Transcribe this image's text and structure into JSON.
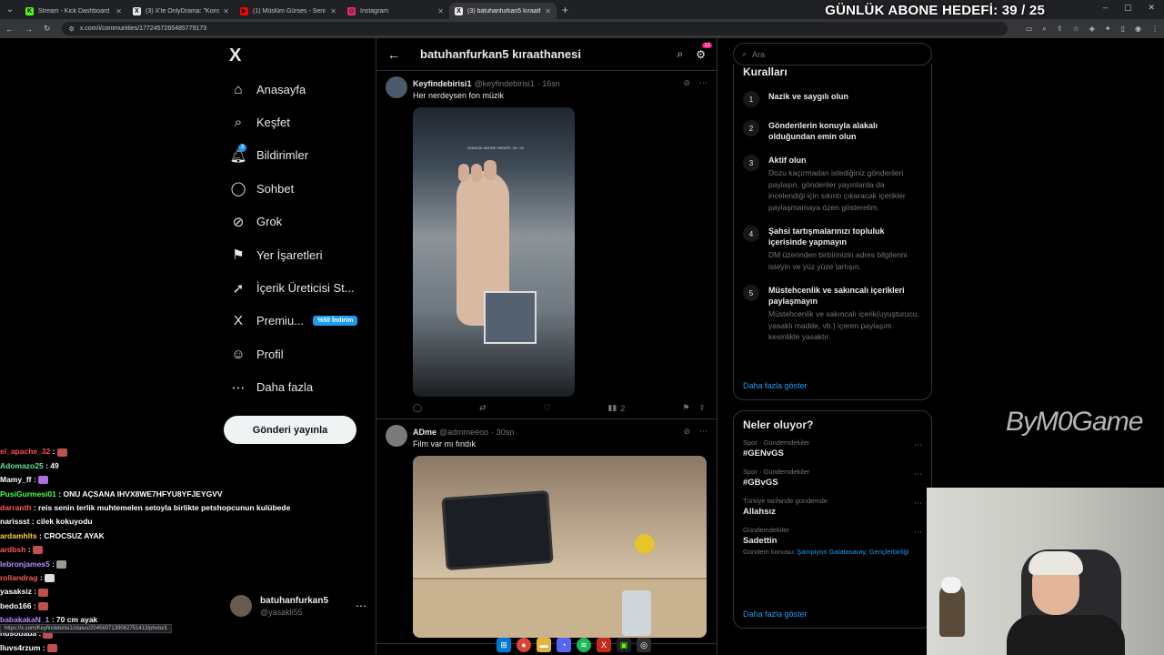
{
  "browser": {
    "tabs": [
      {
        "title": "Stream - Kick Dashboard",
        "fav_color": "#53fc18",
        "fav_glyph": "K",
        "active": false
      },
      {
        "title": "(3) X'te OnlyDrama: \"Konsol O",
        "fav_color": "#e7e9ea",
        "fav_glyph": "X",
        "active": false
      },
      {
        "title": "(1) Müslüm Gürses - Seni Yazdı",
        "fav_color": "#ff0000",
        "fav_glyph": "▶",
        "active": false
      },
      {
        "title": "Instagram",
        "fav_color": "#e1306c",
        "fav_glyph": "◎",
        "active": false
      },
      {
        "title": "(3) batuhanfurkan5 kıraathanes",
        "fav_color": "#e7e9ea",
        "fav_glyph": "X",
        "active": true
      }
    ],
    "url": "x.com/i/communities/1772457265485779173",
    "status_url": "https://x.com/Keyfindebirisi1/status/2045607139062751413/photo/1"
  },
  "overlay": {
    "abone_hedefi": "GÜNLÜK ABONE HEDEFİ: 39 / 25",
    "watermark": "ByM0Game"
  },
  "x_nav": {
    "logo": "X",
    "items": [
      {
        "label": "Anasayfa",
        "icon": "home-icon",
        "glyph": "⌂"
      },
      {
        "label": "Keşfet",
        "icon": "search-icon",
        "glyph": "⌕"
      },
      {
        "label": "Bildirimler",
        "icon": "bell-icon",
        "glyph": "🔔︎",
        "badge": "3"
      },
      {
        "label": "Sohbet",
        "icon": "chat-icon",
        "glyph": "◯"
      },
      {
        "label": "Grok",
        "icon": "grok-icon",
        "glyph": "⊘"
      },
      {
        "label": "Yer İşaretleri",
        "icon": "bookmark-icon",
        "glyph": "⚑"
      },
      {
        "label": "İçerik Üreticisi St...",
        "icon": "rocket-icon",
        "glyph": "➚"
      },
      {
        "label": "Premiu...",
        "icon": "x-premium-icon",
        "glyph": "X",
        "promo": "%50 İndirim"
      },
      {
        "label": "Profil",
        "icon": "profile-icon",
        "glyph": "☺"
      },
      {
        "label": "Daha fazla",
        "icon": "more-icon",
        "glyph": "⋯"
      }
    ],
    "post_button": "Gönderi yayınla",
    "profile_name": "batuhanfurkan5",
    "profile_handle": "@yasakli55"
  },
  "community": {
    "title": "batuhanfurkan5 kıraathanesi",
    "settings_badge": "12"
  },
  "tweets": [
    {
      "name": "Keyfindebirisi1",
      "handle": "@keyfindebirisi1",
      "time": "· 16sn",
      "text": "Her nerdeysen fon müzik",
      "views": "2"
    },
    {
      "name": "ADme",
      "handle": "@admmeeoo",
      "time": "· 30sn",
      "text": "Film var mı fındık",
      "views": ""
    }
  ],
  "media_text": "GÜNLÜK ABONE HEDEFİ: 39 / 25",
  "search": {
    "placeholder": "Ara"
  },
  "rules": {
    "title": "Kuralları",
    "items": [
      {
        "num": "1",
        "title": "Nazik ve saygılı olun",
        "desc": ""
      },
      {
        "num": "2",
        "title": "Gönderilerin konuyla alakalı olduğundan emin olun",
        "desc": ""
      },
      {
        "num": "3",
        "title": "Aktif olun",
        "desc": "Dozu kaçırmadan istediğiniz gönderileri paylaşın, gönderiler yayınlarda da incelendiği için sıkıntı çıkaracak içerikler paylaşmamaya özen gösterelim."
      },
      {
        "num": "4",
        "title": "Şahsi tartışmalarınızı topluluk içerisinde yapmayın",
        "desc": "DM üzerinden birbirinizin adres bilgilerini isteyin ve yüz yüze tartışın."
      },
      {
        "num": "5",
        "title": "Müstehcenlik ve sakıncalı içerikleri paylaşmayın",
        "desc": "Müstehcenlik ve sakıncalı içerik(uyuşturucu, yasaklı madde, vb.) içeren paylaşım kesinlikle yasaktır."
      }
    ],
    "more": "Daha fazla göster"
  },
  "trends": {
    "title": "Neler oluyor?",
    "items": [
      {
        "context": "Spor · Gündemdekiler",
        "name": "#GENvGS",
        "sub": "",
        "link": ""
      },
      {
        "context": "Spor · Gündemdekiler",
        "name": "#GBvGS",
        "sub": "",
        "link": ""
      },
      {
        "context": "Türkiye tarihinde gündemde",
        "name": "Allahsız",
        "sub": "",
        "link": ""
      },
      {
        "context": "Gündemdekiler",
        "name": "Sadettin",
        "sub": "Gündem konusu:",
        "link": "Şampiyon Galatasaray, Gençlerbirliği"
      }
    ],
    "more": "Daha fazla göster"
  },
  "chat": [
    {
      "user": "",
      "msg": "",
      "color": "#ff9f40"
    },
    {
      "user": "el_apache_32",
      "msg": ":",
      "color": "#ff4b4b",
      "emote": "#c0504d"
    },
    {
      "user": "Adomazo25",
      "msg": ": 49",
      "color": "#66e0a3"
    },
    {
      "user": "Mamy_ff",
      "msg": ":",
      "color": "#ffffff",
      "emote": "#b06de0"
    },
    {
      "user": "PusiGurmesi01",
      "msg": ": ONU AÇSANA IHVX8WE7HFYU8YFJEYGVV",
      "color": "#4cff4c"
    },
    {
      "user": "darranth",
      "msg": ": reis senin terlik muhtemelen setoyla birlikte petshopcunun kulübede",
      "color": "#ff5a5a"
    },
    {
      "user": "narissst",
      "msg": ": cilek kokuyodu",
      "color": "#ffffff"
    },
    {
      "user": "ardamhlts",
      "msg": ": CROCSUZ AYAK",
      "color": "#ffd24a"
    },
    {
      "user": "ardbsh",
      "msg": ":",
      "color": "#ff5a5a",
      "emote": "#c0504d"
    },
    {
      "user": "lebronjames5",
      "msg": ":",
      "color": "#b58cff",
      "emote": "#999999"
    },
    {
      "user": "rollandrag",
      "msg": ":",
      "color": "#ff5a5a",
      "emote": "#dddddd"
    },
    {
      "user": "yasaksiz",
      "msg": ":",
      "color": "#ffffff",
      "emote": "#c0504d"
    },
    {
      "user": "bedo166",
      "msg": ":",
      "color": "#ffffff",
      "emote": "#c0504d"
    },
    {
      "user": "babakakaN_1",
      "msg": ": 70 cm ayak",
      "color": "#b58cff"
    },
    {
      "user": "husobaba",
      "msg": ":",
      "color": "#ffffff",
      "emote": "#c0504d"
    },
    {
      "user": "lluvs4rzum",
      "msg": ":",
      "color": "#ffffff",
      "emote": "#c0504d"
    }
  ],
  "colors": {
    "accent": "#1d9bf0",
    "background": "#000000",
    "border": "#2f3336",
    "muted": "#71767b"
  }
}
